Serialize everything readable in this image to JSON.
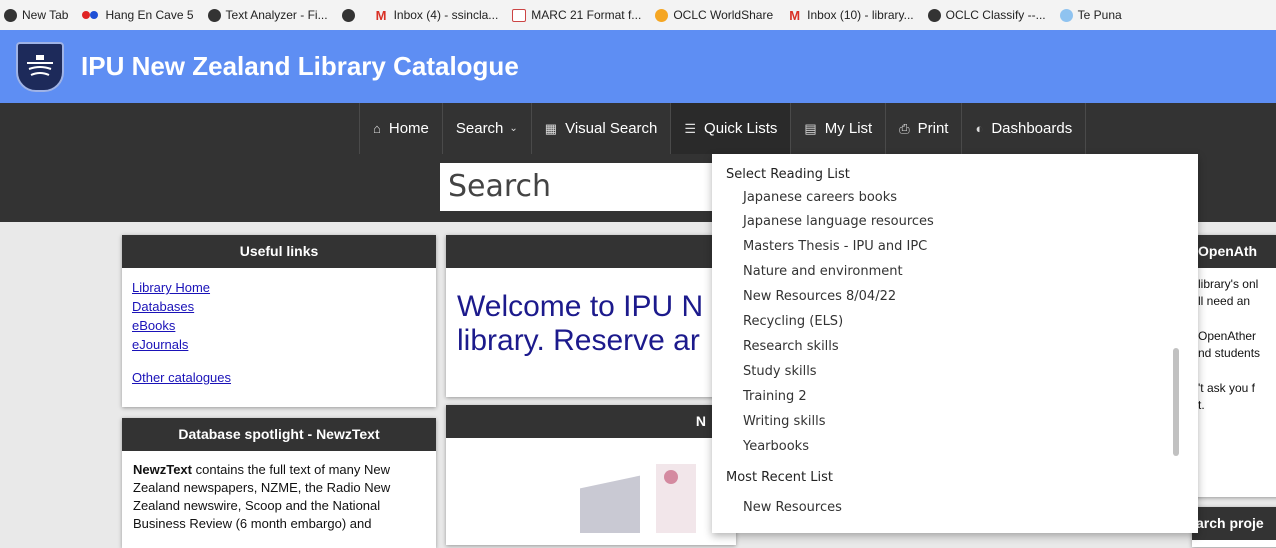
{
  "bookmarks": [
    {
      "label": "New Tab",
      "icon": "globe-icon"
    },
    {
      "label": "Hang En Cave 5",
      "icon": "flickr-icon"
    },
    {
      "label": "Text Analyzer - Fi...",
      "icon": "globe-icon"
    },
    {
      "label": "",
      "icon": "globe-icon"
    },
    {
      "label": "Inbox (4) - ssincla...",
      "icon": "gmail-icon"
    },
    {
      "label": "MARC 21 Format f...",
      "icon": "marc-icon"
    },
    {
      "label": "OCLC WorldShare",
      "icon": "oclc-icon"
    },
    {
      "label": "Inbox (10) - library...",
      "icon": "gmail-icon"
    },
    {
      "label": "OCLC Classify --...",
      "icon": "globe-icon"
    },
    {
      "label": "Te Puna",
      "icon": "te-puna-icon"
    }
  ],
  "header": {
    "title": "IPU New Zealand Library Catalogue"
  },
  "nav": {
    "home": "Home",
    "search": "Search",
    "visual_search": "Visual Search",
    "quick_lists": "Quick Lists",
    "my_list": "My List",
    "print": "Print",
    "dashboards": "Dashboards"
  },
  "search": {
    "placeholder": "Search"
  },
  "useful_links": {
    "title": "Useful links",
    "items": [
      "Library Home",
      "Databases",
      "eBooks",
      "eJournals"
    ],
    "other": "Other catalogues"
  },
  "spotlight": {
    "title": "Database spotlight - NewzText",
    "bold": "NewzText",
    "text": " contains the full text of many New Zealand newspapers, NZME, the Radio New Zealand newswire, Scoop and the National Business Review (6 month embargo) and"
  },
  "center": {
    "welcome_line1": "Welcome to IPU N",
    "welcome_line2": "library. Reserve ar",
    "second_head": "N"
  },
  "right": {
    "title": "OpenAth",
    "lines": [
      "library's onl",
      "ll need an",
      "OpenAther",
      "nd students",
      "'t ask you f",
      "t."
    ],
    "bottom_head": "arch proje"
  },
  "dropdown": {
    "reading_list_label": "Select Reading List",
    "reading_lists": [
      "Japanese careers books",
      "Japanese language resources",
      "Masters Thesis - IPU and IPC",
      "Nature and environment",
      "New Resources 8/04/22",
      "Recycling (ELS)",
      "Research skills",
      "Study skills",
      "Training 2",
      "Writing skills",
      "Yearbooks"
    ],
    "recent_label": "Most Recent List",
    "recent_items": [
      "New Resources"
    ]
  }
}
